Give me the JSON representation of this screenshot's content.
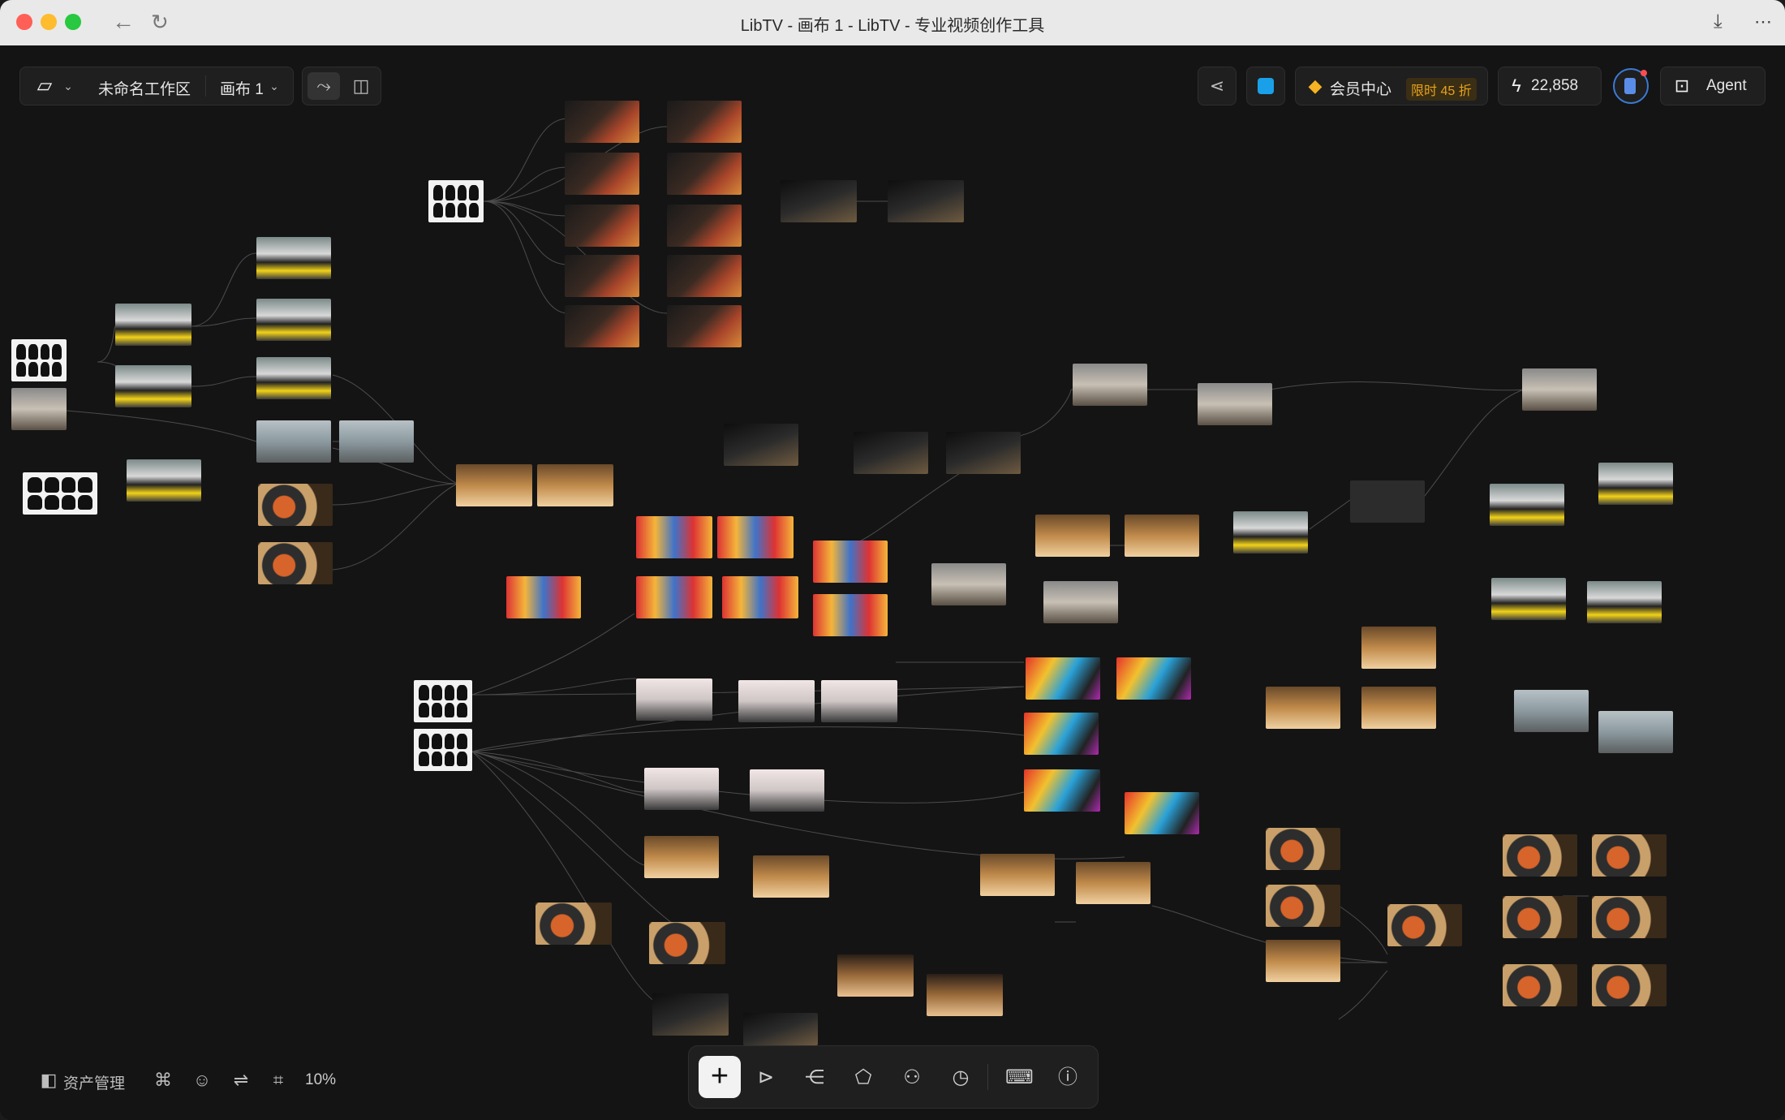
{
  "window": {
    "title": "LibTV - 画布 1 - LibTV - 专业视频创作工具"
  },
  "toolbar_left": {
    "workspace_name": "未命名工作区",
    "canvas_name": "画布 1"
  },
  "toolbar_right": {
    "member_center": "会员中心",
    "member_promo": "限时 45 折",
    "credits": "22,858",
    "agent_label": "Agent"
  },
  "bottom_left": {
    "assets_label": "资产管理",
    "zoom": "10%"
  },
  "icons": {
    "logo": "libtv-logo-icon",
    "share": "share-icon",
    "storage": "layers-icon",
    "diamond": "diamond-icon",
    "bolt": "lightning-icon",
    "add": "plus-icon",
    "select": "cursor-icon",
    "workflow": "node-graph-icon",
    "keyboard": "keyboard-icon",
    "help": "help-icon"
  },
  "colors": {
    "canvas_bg": "#141414",
    "panel_bg": "#1f1f1f",
    "accent_blue": "#1a73e8",
    "promo_gold": "#e8a21a",
    "diamond_gold": "#f5b324"
  }
}
